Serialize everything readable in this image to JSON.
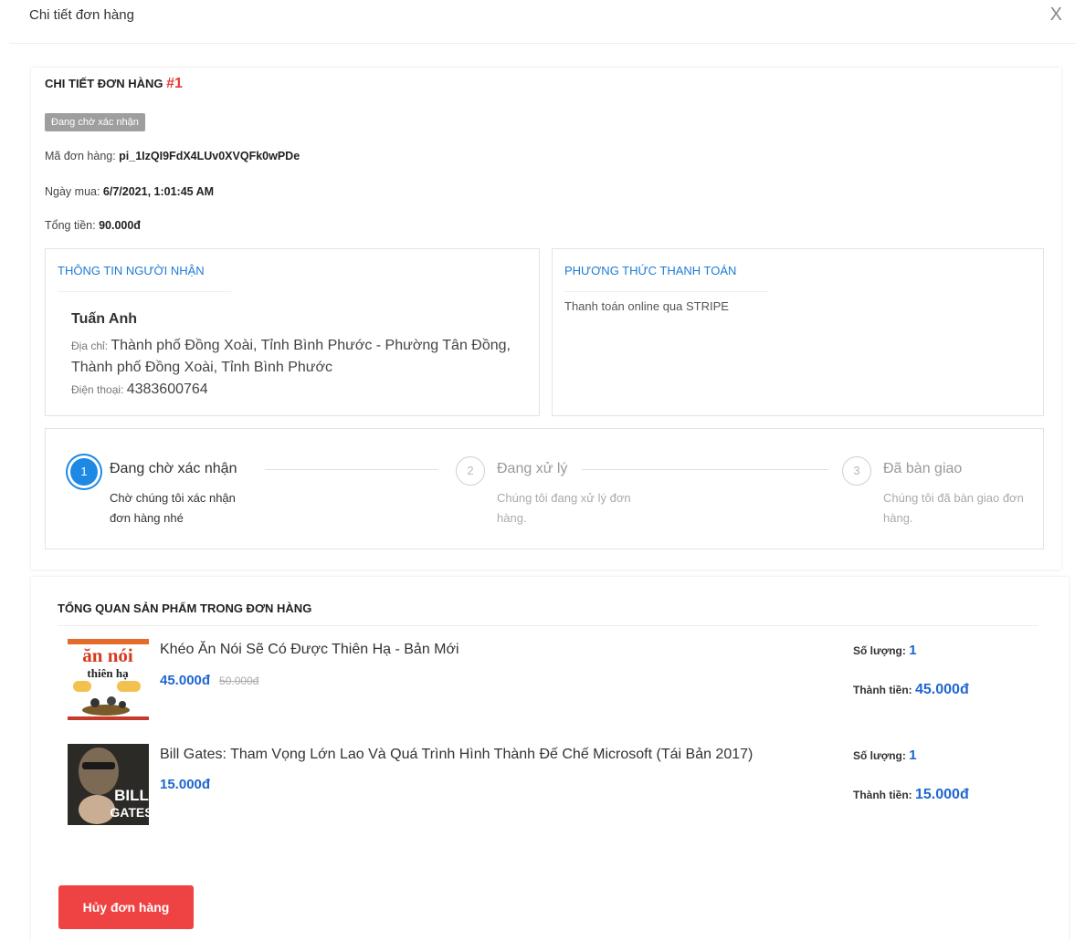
{
  "modal": {
    "title": "Chi tiết đơn hàng",
    "close_glyph": "X"
  },
  "order": {
    "heading": "CHI TIẾT ĐƠN HÀNG ",
    "number": "#1",
    "status": "Đang chờ xác nhận",
    "code_label": "Mã đơn hàng: ",
    "code_value": "pi_1IzQI9FdX4LUv0XVQFk0wPDe",
    "date_label": "Ngày mua: ",
    "date_value": "6/7/2021, 1:01:45 AM",
    "total_label": "Tổng tiền: ",
    "total_value": "90.000đ"
  },
  "recipient": {
    "title": "THÔNG TIN NGƯỜI NHẬN",
    "name": "Tuấn Anh",
    "address_label": "Địa chỉ: ",
    "address_value": "Thành phố Đồng Xoài, Tỉnh Bình Phước - Phường Tân Đồng, Thành phố Đồng Xoài, Tỉnh Bình Phước",
    "phone_label": "Điện thoại: ",
    "phone_value": "4383600764"
  },
  "payment": {
    "title": "PHƯƠNG THỨC THANH TOÁN",
    "method": "Thanh toán online qua STRIPE"
  },
  "steps": [
    {
      "num": "1",
      "title": "Đang chờ xác nhận",
      "desc": "Chờ chúng tôi xác nhận đơn hàng nhé"
    },
    {
      "num": "2",
      "title": "Đang xử lý",
      "desc": "Chúng tôi đang xử lý đơn hàng."
    },
    {
      "num": "3",
      "title": "Đã bàn giao",
      "desc": "Chúng tôi đã bàn giao đơn hàng."
    }
  ],
  "products": {
    "title": "TỔNG QUAN SẢN PHẨM TRONG ĐƠN HÀNG",
    "qty_label": "Số lượng: ",
    "subtotal_label": "Thành tiền: ",
    "items": [
      {
        "name": "Khéo Ăn Nói Sẽ Có Được Thiên Hạ - Bản Mới",
        "price": "45.000đ",
        "old_price": "50.000đ",
        "qty": "1",
        "subtotal": "45.000đ",
        "cover_text_1": "ăn nói",
        "cover_text_2": "thiên hạ"
      },
      {
        "name": "Bill Gates: Tham Vọng Lớn Lao Và Quá Trình Hình Thành Đế Chế Microsoft (Tái Bản 2017)",
        "price": "15.000đ",
        "old_price": "",
        "qty": "1",
        "subtotal": "15.000đ",
        "cover_text_1": "BILL",
        "cover_text_2": "GATES"
      }
    ]
  },
  "cancel_button": "Hủy đơn hàng"
}
